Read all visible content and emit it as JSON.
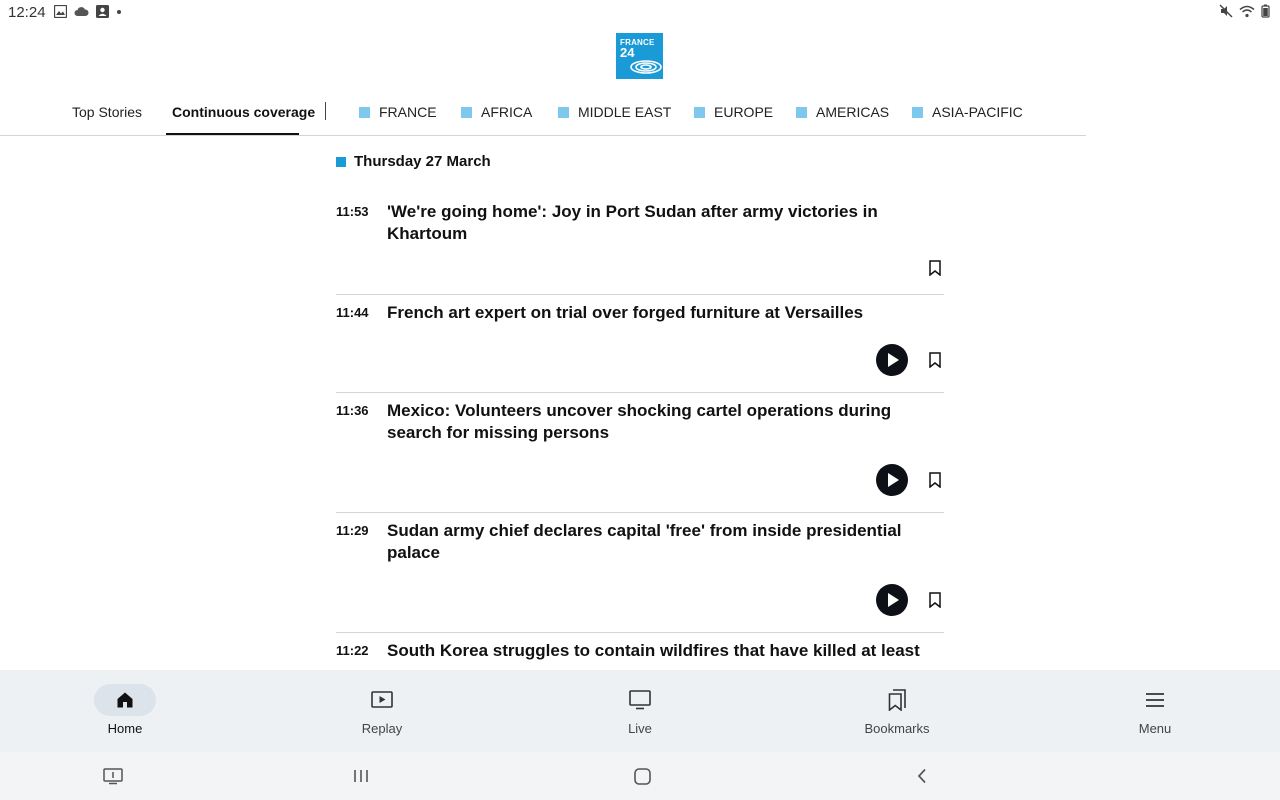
{
  "status_bar": {
    "time": "12:24",
    "icons_left": [
      "image-icon",
      "cloud-icon",
      "account-box-icon",
      "dot-icon"
    ],
    "icons_right": [
      "mute-icon",
      "wifi-icon",
      "battery-icon"
    ]
  },
  "brand": {
    "line1": "FRANCE",
    "line2": "24",
    "color": "#1a9ad6"
  },
  "tabs": [
    {
      "label": "Top Stories",
      "active": false
    },
    {
      "label": "Continuous coverage",
      "active": true
    }
  ],
  "regions": [
    {
      "label": "FRANCE",
      "color": "#7ec8ee"
    },
    {
      "label": "AFRICA",
      "color": "#7ec8ee"
    },
    {
      "label": "MIDDLE EAST",
      "color": "#7ec8ee"
    },
    {
      "label": "EUROPE",
      "color": "#7ec8ee"
    },
    {
      "label": "AMERICAS",
      "color": "#7ec8ee"
    },
    {
      "label": "ASIA-PACIFIC",
      "color": "#7ec8ee"
    }
  ],
  "feed": {
    "date": "Thursday 27 March",
    "items": [
      {
        "time": "11:53",
        "title": "'We're going home': Joy in Port Sudan after army victories in Khartoum",
        "has_video": false
      },
      {
        "time": "11:44",
        "title": "French art expert on trial over forged furniture at Versailles",
        "has_video": true
      },
      {
        "time": "11:36",
        "title": "Mexico: Volunteers uncover shocking cartel operations during search for missing persons",
        "has_video": true
      },
      {
        "time": "11:29",
        "title": "Sudan army chief declares capital 'free' from inside presidential palace",
        "has_video": true
      },
      {
        "time": "11:22",
        "title": "South Korea struggles to contain wildfires that have killed at least",
        "has_video": false
      }
    ]
  },
  "bottom_nav": [
    {
      "label": "Home",
      "icon": "home-icon",
      "active": true
    },
    {
      "label": "Replay",
      "icon": "replay-icon",
      "active": false
    },
    {
      "label": "Live",
      "icon": "live-tv-icon",
      "active": false
    },
    {
      "label": "Bookmarks",
      "icon": "bookmarks-icon",
      "active": false
    },
    {
      "label": "Menu",
      "icon": "menu-icon",
      "active": false
    }
  ],
  "system_nav": [
    "screenshot-icon",
    "recent-apps-icon",
    "home-circle-icon",
    "back-icon"
  ]
}
